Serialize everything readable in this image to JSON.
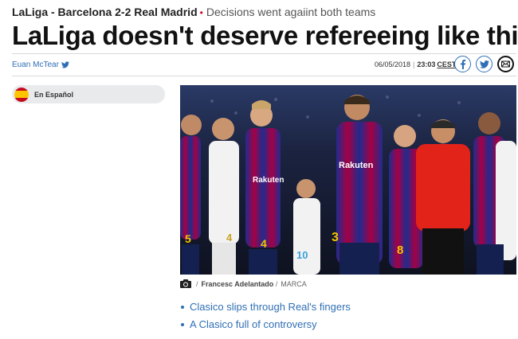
{
  "kicker": {
    "match": "LaLiga - Barcelona 2-2 Real Madrid",
    "subtitle": "Decisions went agaiint both teams"
  },
  "headline": "LaLiga doesn't deserve refereeing like this",
  "byline": {
    "author": "Euan McTear",
    "author_icon": "twitter-bird-icon",
    "date": "06/05/2018",
    "time": "23:03",
    "timezone": "CEST"
  },
  "share": [
    {
      "network": "facebook",
      "icon": "facebook-icon"
    },
    {
      "network": "twitter",
      "icon": "twitter-icon"
    },
    {
      "network": "email",
      "icon": "mail-icon"
    }
  ],
  "language_switch": {
    "label": "En Español",
    "flag_icon": "spain-flag-icon"
  },
  "photo": {
    "photographer": "Francesc Adelantado",
    "agency": "MARCA",
    "credit_icon": "camera-icon",
    "description_players": [
      {
        "team": "barcelona",
        "number": "5"
      },
      {
        "team": "real-madrid",
        "number": "4"
      },
      {
        "team": "barcelona",
        "number": "4"
      },
      {
        "team": "real-madrid",
        "number": "10"
      },
      {
        "team": "barcelona",
        "number": "3"
      },
      {
        "team": "barcelona",
        "number": "8"
      }
    ]
  },
  "related_links": [
    "Clasico slips through Real's fingers",
    "A Clasico full of controversy"
  ],
  "colors": {
    "link_blue": "#2f6fb5",
    "accent_red": "#d0021b",
    "barca_blue": "#1f2c8f",
    "barca_red": "#a50044",
    "madrid_white": "#f2f2f2",
    "referee_red": "#e2231a"
  }
}
